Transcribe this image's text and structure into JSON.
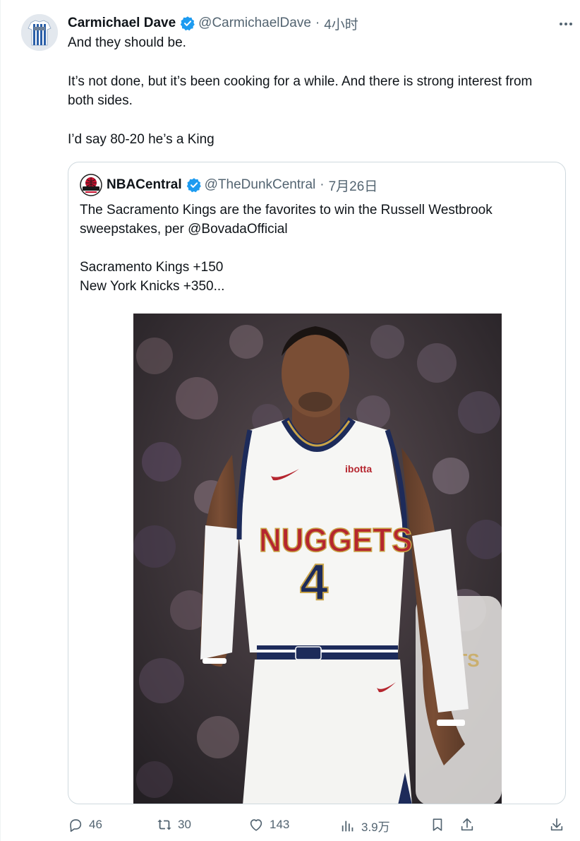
{
  "tweet": {
    "author_name": "Carmichael Dave",
    "author_handle": "@CarmichaelDave",
    "separator": "·",
    "time": "4小时",
    "lines": [
      "And they should be.",
      "It’s not done, but it’s been cooking for a while. And there is strong interest from both sides.",
      "I’d say 80-20 he’s a King"
    ]
  },
  "quoted": {
    "author_name": "NBACentral",
    "author_handle": "@TheDunkCentral",
    "separator": "·",
    "time": "7月26日",
    "lines": [
      "The Sacramento Kings are the favorites to win the Russell Westbrook sweepstakes, per @BovadaOfficial",
      "Sacramento Kings +150",
      "New York Knicks +350..."
    ],
    "photo": {
      "jersey_wordmark": "NUGGETS",
      "jersey_number": "4",
      "jersey_sponsor": "ibotta"
    }
  },
  "actions": {
    "replies": "46",
    "reposts": "30",
    "likes": "143",
    "views": "3.9万"
  },
  "colors": {
    "text": "#0f1419",
    "secondary": "#536471",
    "verified": "#1d9bf0",
    "border": "#cfd9de",
    "nuggets_red": "#b5262f",
    "nuggets_navy": "#1d2b5a",
    "nuggets_gold": "#c9a448"
  },
  "icons": [
    "verified-badge-icon",
    "more-icon",
    "reply-icon",
    "repost-icon",
    "like-icon",
    "views-icon",
    "bookmark-icon",
    "share-icon",
    "download-icon"
  ]
}
